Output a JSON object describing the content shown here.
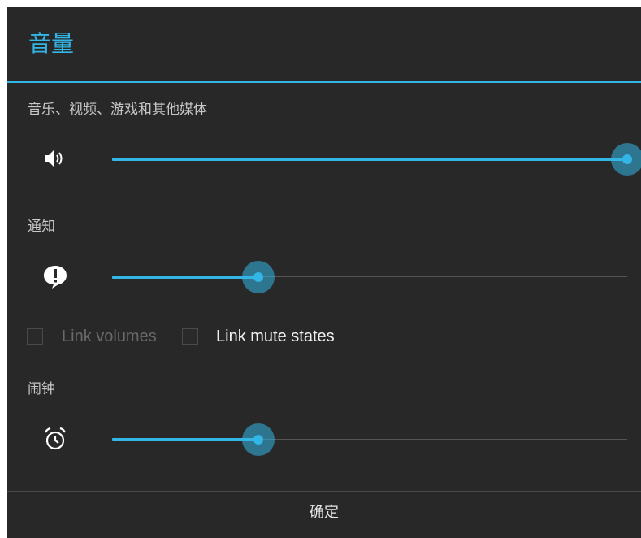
{
  "dialog": {
    "title": "音量",
    "accent_color": "#33b5e5",
    "ok_label": "确定"
  },
  "sections": {
    "media": {
      "label": "音乐、视频、游戏和其他媒体",
      "icon": "speaker-volume-icon",
      "level": 1.0
    },
    "notification": {
      "label": "通知",
      "icon": "notification-alert-icon",
      "level": 0.284
    },
    "alarm": {
      "label": "闹钟",
      "icon": "alarm-clock-icon",
      "level": 0.284
    }
  },
  "options": {
    "link_volumes": {
      "label": "Link volumes",
      "checked": false,
      "enabled": false
    },
    "link_mute_states": {
      "label": "Link mute states",
      "checked": false,
      "enabled": true
    }
  }
}
